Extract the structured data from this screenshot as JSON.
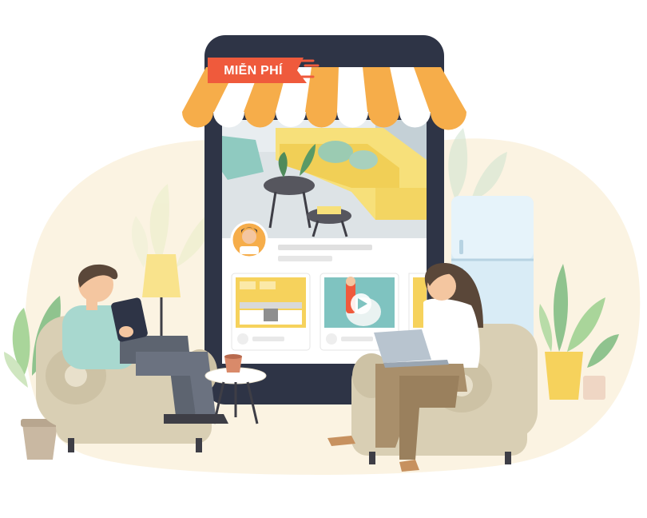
{
  "badge": {
    "label": "MIỄN PHÍ"
  },
  "colors": {
    "tablet_frame": "#2e3446",
    "badge_red": "#ef5a3c",
    "awning_orange": "#f6ad4a",
    "awning_white": "#ffffff",
    "sofa_yellow": "#f7e07a",
    "armchair_beige": "#d9cfb4",
    "blob_cream": "#fbf3e2",
    "fridge_blue": "#d9ecf6",
    "plant_green": "#8fc38e"
  },
  "icons": [
    "avatar",
    "play-icon",
    "laptop",
    "tablet-device",
    "coffee-cup",
    "floor-lamp",
    "potted-plant",
    "refrigerator"
  ]
}
